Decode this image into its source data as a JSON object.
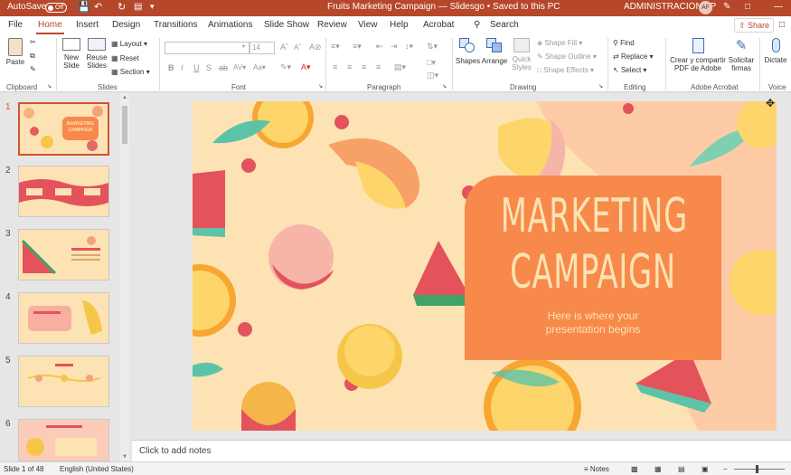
{
  "titlebar": {
    "autosave_label": "AutoSave",
    "autosave_state": "Off",
    "document_title": "Fruits Marketing Campaign — Slidesgo  •  Saved to this PC",
    "user_name": "ADMINISTRACION FP",
    "user_initials": "AF"
  },
  "menu": {
    "tabs": [
      "File",
      "Home",
      "Insert",
      "Design",
      "Transitions",
      "Animations",
      "Slide Show",
      "Review",
      "View",
      "Help",
      "Acrobat"
    ],
    "search_label": "Search",
    "share_label": "Share"
  },
  "ribbon": {
    "clipboard": {
      "paste": "Paste",
      "group": "Clipboard"
    },
    "slides": {
      "new_slide": "New\nSlide",
      "reuse_slides": "Reuse\nSlides",
      "layout": "Layout",
      "reset": "Reset",
      "section": "Section",
      "group": "Slides"
    },
    "font": {
      "font_name": "",
      "font_size": "14",
      "group": "Font"
    },
    "paragraph": {
      "group": "Paragraph"
    },
    "drawing": {
      "shapes": "Shapes",
      "arrange": "Arrange",
      "quick_styles": "Quick\nStyles",
      "shape_fill": "Shape Fill",
      "shape_outline": "Shape Outline",
      "shape_effects": "Shape Effects",
      "group": "Drawing"
    },
    "editing": {
      "find": "Find",
      "replace": "Replace",
      "select": "Select",
      "group": "Editing"
    },
    "acrobat": {
      "create_share": "Crear y compartir\nPDF de Adobe",
      "request_sign": "Solicitar\nfirmas",
      "group": "Adobe Acrobat"
    },
    "voice": {
      "dictate": "Dictate",
      "group": "Voice"
    }
  },
  "thumbnails": {
    "numbers": [
      "1",
      "2",
      "3",
      "4",
      "5",
      "6"
    ],
    "selected": "1",
    "thumb1_title": "MARKETING CAMPAIGN"
  },
  "slide": {
    "title_line1": "MARKETING",
    "title_line2": "CAMPAIGN",
    "subtitle_line1": "Here is where your",
    "subtitle_line2": "presentation begins"
  },
  "notes": {
    "placeholder": "Click to add notes"
  },
  "status": {
    "slide_info": "Slide 1 of 48",
    "language": "English (United States)",
    "notes_label": "Notes"
  },
  "colors": {
    "brand": "#b7472a",
    "slide_bg": "#fde3b3",
    "title_box": "#f7894a",
    "title_text": "#fde3b3"
  }
}
